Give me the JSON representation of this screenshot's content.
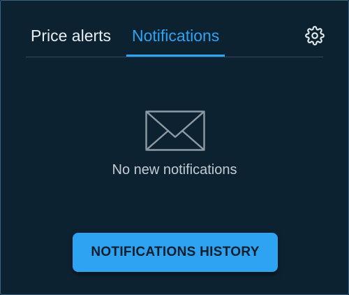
{
  "tabs": [
    {
      "label": "Price alerts",
      "active": false
    },
    {
      "label": "Notifications",
      "active": true
    }
  ],
  "header": {
    "settings_icon": "gear-icon"
  },
  "empty_state": {
    "icon": "envelope-icon",
    "message": "No new notifications"
  },
  "actions": {
    "history_label": "NOTIFICATIONS HISTORY"
  },
  "colors": {
    "background": "#0d2231",
    "accent": "#2ea3f2",
    "text": "#e8edf1",
    "muted_text": "#c4ccd3"
  }
}
